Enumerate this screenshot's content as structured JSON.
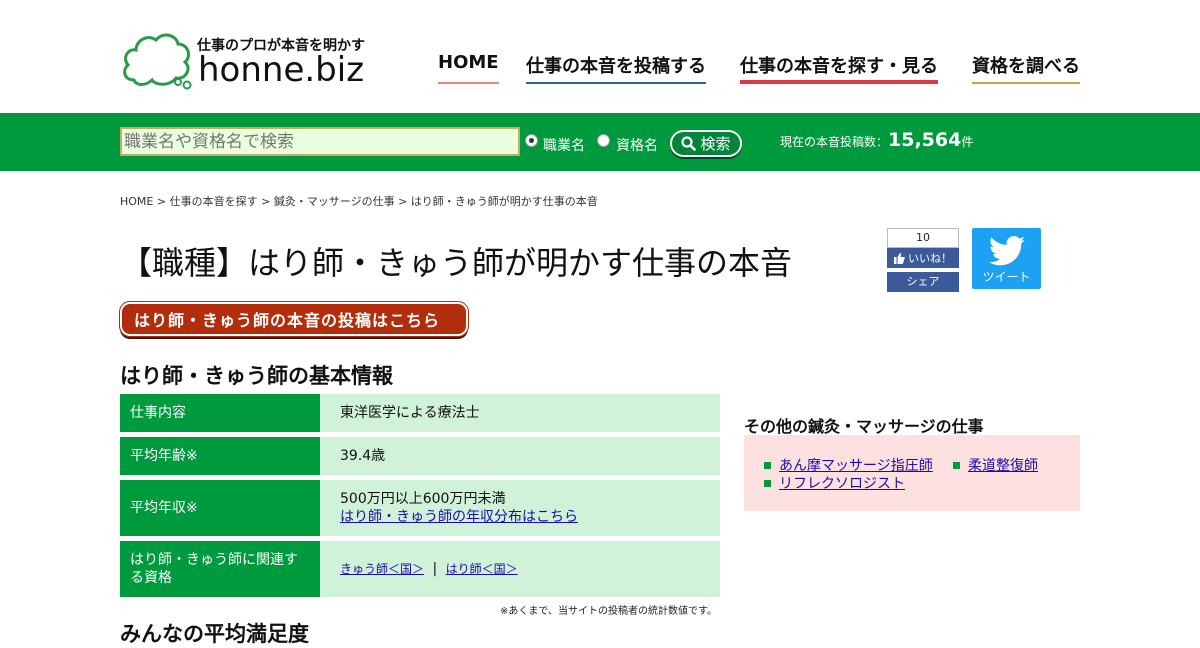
{
  "header": {
    "tagline": "仕事のプロが本音を明かす",
    "logo_text": "honne.biz",
    "nav": [
      {
        "label": "HOME"
      },
      {
        "label": "仕事の本音を投稿する"
      },
      {
        "label": "仕事の本音を探す・見る"
      },
      {
        "label": "資格を調べる"
      }
    ],
    "colors": {
      "green": "#009a3e",
      "nav_active": "#d83a48"
    }
  },
  "search": {
    "placeholder": "職業名や資格名で検索",
    "radio_job": "職業名",
    "radio_qual": "資格名",
    "button_label": "検索",
    "count_label": "現在の本音投稿数：",
    "count_value": "15,564",
    "count_unit": "件"
  },
  "breadcrumb": "HOME > 仕事の本音を探す > 鍼灸・マッサージの仕事 > はり師・きゅう師が明かす仕事の本音",
  "page_title": "【職種】はり師・きゅう師が明かす仕事の本音",
  "social": {
    "fb_count": "10",
    "fb_like": "いいね！",
    "fb_share": "シェア",
    "tweet": "ツイート"
  },
  "post_button": "はり師・きゅう師の本音の投稿はこちら",
  "basic_info": {
    "title": "はり師・きゅう師の基本情報",
    "rows": [
      {
        "key": "仕事内容",
        "value": "東洋医学による療法士"
      },
      {
        "key": "平均年齢※",
        "value": "39.4歳"
      },
      {
        "key": "平均年収※",
        "value": "500万円以上600万円未満",
        "link": "はり師・きゅう師の年収分布はこちら"
      },
      {
        "key": "はり師・きゅう師に関連する資格",
        "links": [
          "きゅう師＜国＞",
          "はり師＜国＞"
        ],
        "separator": "|"
      }
    ],
    "note": "※あくまで、当サイトの投稿者の統計数値です。"
  },
  "bottom_title": "みんなの平均満足度",
  "sidebar": {
    "title": "その他の鍼灸・マッサージの仕事",
    "items": [
      "あん摩マッサージ指圧師",
      "柔道整復師",
      "リフレクソロジスト"
    ]
  }
}
